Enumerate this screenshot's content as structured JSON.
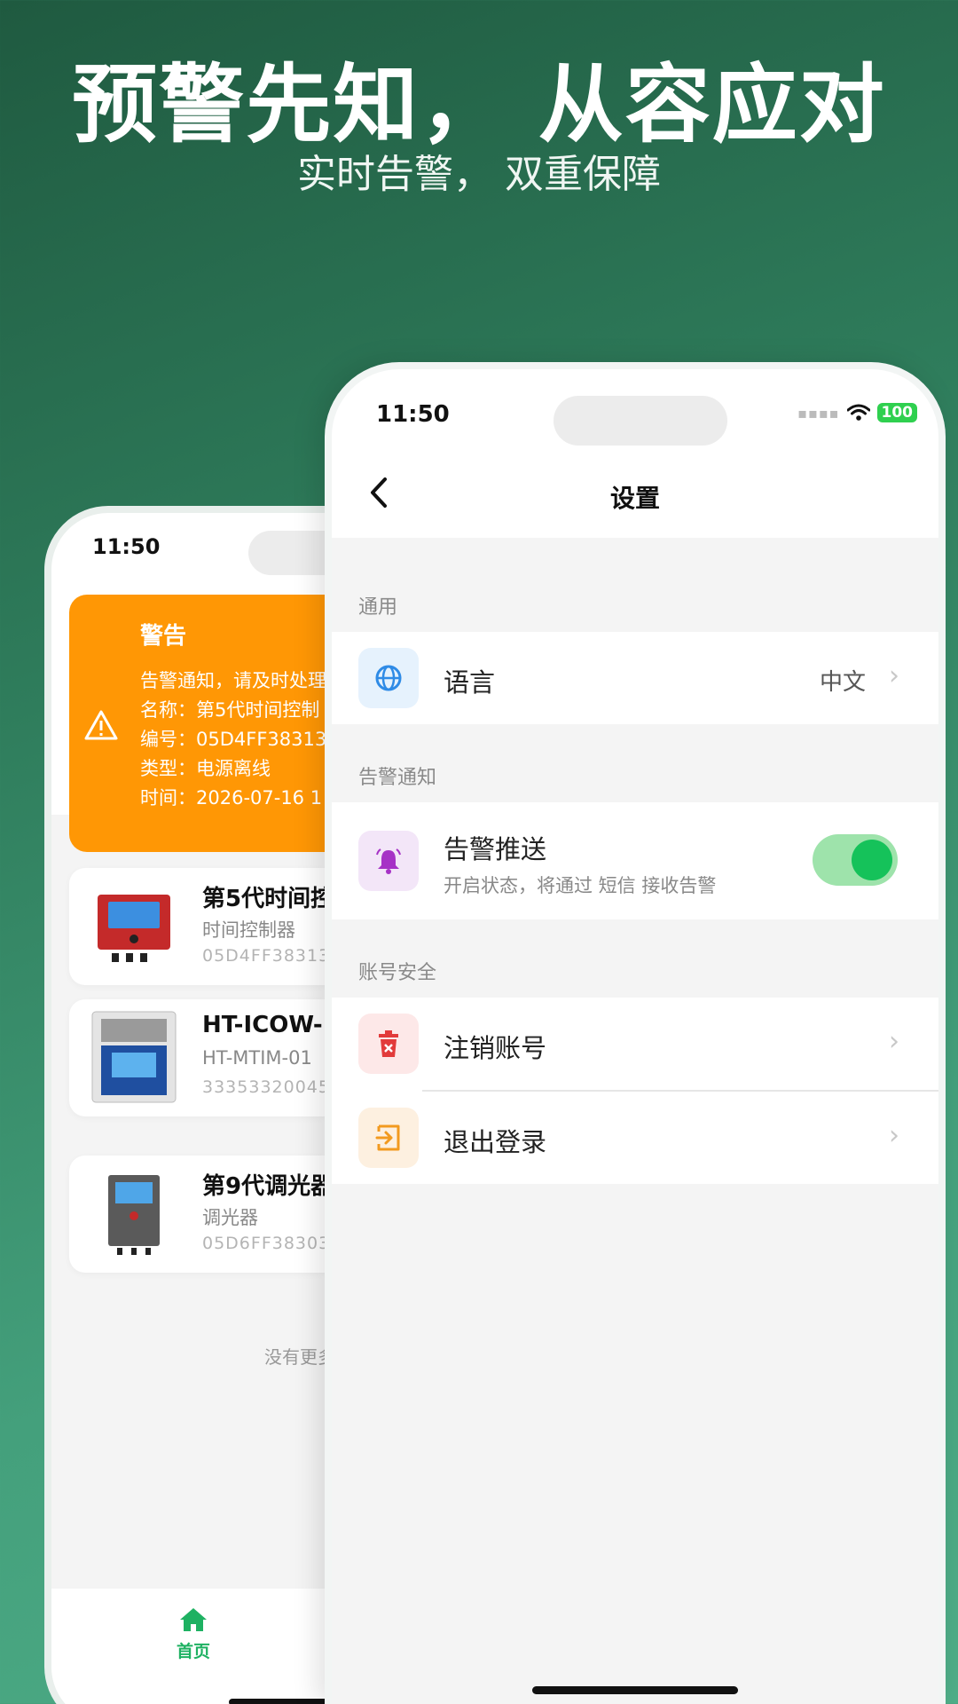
{
  "hero": {
    "headline": "预警先知， 从容应对",
    "subline": "实时告警， 双重保障"
  },
  "back_phone": {
    "status_time": "11:50",
    "alert": {
      "title": "警告",
      "lines": [
        "告警通知，请及时处理",
        "名称：第5代时间控制",
        "编号：05D4FF38313",
        "类型：电源离线",
        "时间：2026-07-16 1"
      ]
    },
    "devices": [
      {
        "name": "第5代时间控",
        "type": "时间控制器",
        "code": "05D4FF38313"
      },
      {
        "name": "HT-ICOW-",
        "type": "HT-MTIM-01",
        "code": "33353320045"
      },
      {
        "name": "第9代调光器",
        "type": "调光器",
        "code": "05D6FF38303"
      }
    ],
    "no_more": "没有更多",
    "tab_home": "首页"
  },
  "front_phone": {
    "status_time": "11:50",
    "battery": "100",
    "nav_title": "设置",
    "sections": {
      "general": "通用",
      "alert_notify": "告警通知",
      "account_security": "账号安全"
    },
    "language": {
      "label": "语言",
      "value": "中文"
    },
    "alert_push": {
      "label": "告警推送",
      "sub": "开启状态，将通过 短信 接收告警",
      "enabled": true
    },
    "cancel_account": {
      "label": "注销账号"
    },
    "logout": {
      "label": "退出登录"
    },
    "colors": {
      "accent_green": "#15c25a",
      "alert_orange": "#ff9705"
    }
  }
}
